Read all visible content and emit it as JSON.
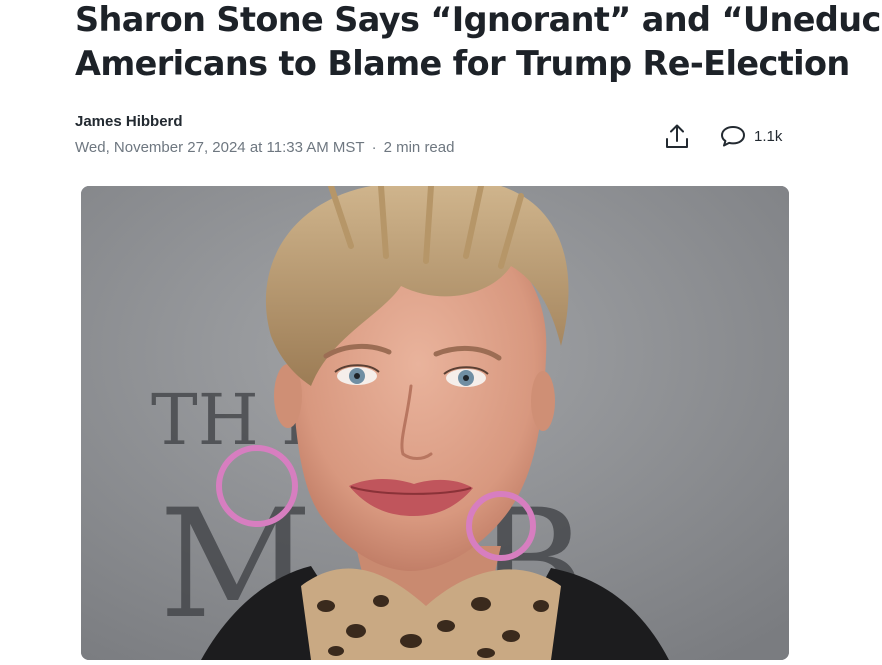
{
  "article": {
    "headline_line1": "Sharon Stone Says “Ignorant” and “Uneducated”",
    "headline_line2": "Americans to Blame for Trump Re-Election",
    "author": "James Hibberd",
    "date": "Wed, November 27, 2024 at 11:33 AM MST",
    "separator": "·",
    "read_time": "2 min read"
  },
  "actions": {
    "share_icon": "share-icon",
    "comment_icon": "comment-icon",
    "comment_count": "1.1k"
  },
  "hero_image": {
    "backdrop_text_top": "TH RAC",
    "backdrop_text_bottom": "M CB"
  },
  "colors": {
    "headline": "#1d2228",
    "meta": "#6e7780",
    "backdrop": "#8d8f93"
  }
}
